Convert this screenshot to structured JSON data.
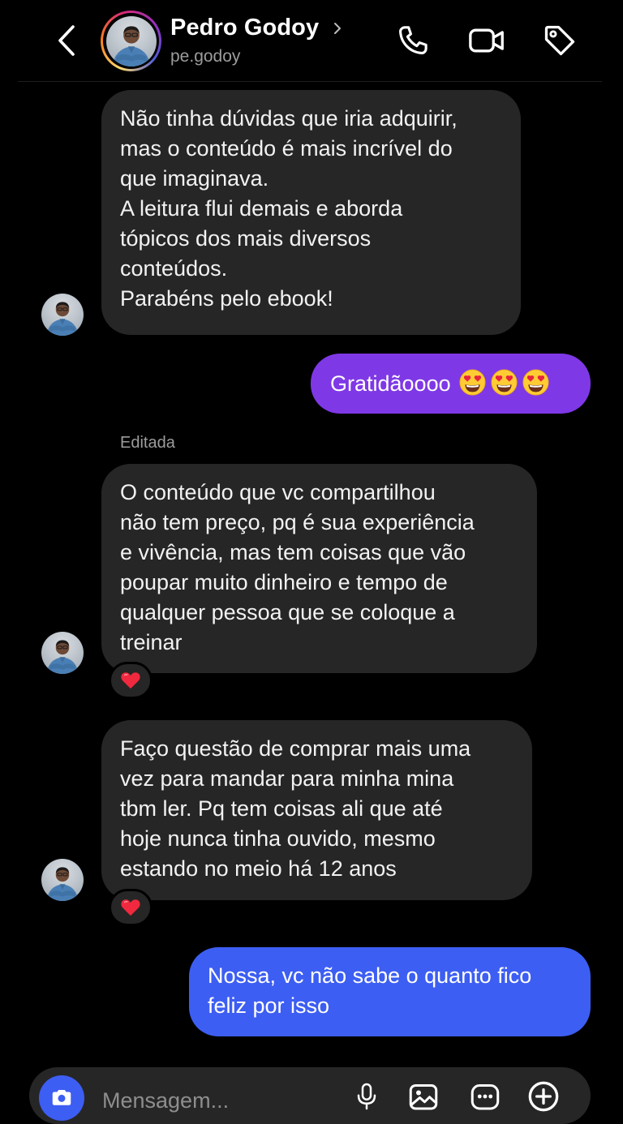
{
  "header": {
    "contact_name": "Pedro Godoy",
    "contact_handle": "pe.godoy",
    "icons": [
      "back-chevron-icon",
      "phone-icon",
      "video-camera-icon",
      "tag-icon"
    ]
  },
  "messages": [
    {
      "direction": "received",
      "lines": [
        "Não tinha dúvidas que iria adquirir,",
        "mas o conteúdo é mais incrível do",
        "que imaginava.",
        "A leitura flui demais e aborda",
        "tópicos dos mais diversos",
        "conteúdos.",
        "Parabéns pelo ebook!"
      ]
    },
    {
      "direction": "sent",
      "text": "Gratidãoooo",
      "emojis": [
        "heart-eyes-emoji",
        "heart-eyes-emoji",
        "heart-eyes-emoji"
      ]
    },
    {
      "direction": "received",
      "edited_label": "Editada",
      "lines": [
        "O conteúdo que vc compartilhou",
        "não tem preço, pq é sua experiência",
        "e vivência, mas tem coisas que vão",
        "poupar muito dinheiro e tempo de",
        "qualquer pessoa que se coloque a",
        "treinar"
      ],
      "reaction": "heart-emoji"
    },
    {
      "direction": "received",
      "lines": [
        "Faço questão de comprar mais uma",
        "vez para mandar para minha mina",
        "tbm ler. Pq tem coisas ali que até",
        "hoje nunca tinha ouvido, mesmo",
        "estando no meio há 12 anos"
      ],
      "reaction": "heart-emoji"
    },
    {
      "direction": "sent",
      "lines": [
        "Nossa, vc não sabe o quanto fico",
        "feliz por isso"
      ]
    }
  ],
  "composer": {
    "placeholder": "Mensagem...",
    "icons": [
      "camera-icon",
      "microphone-icon",
      "gallery-icon",
      "sticker-icon",
      "plus-icon"
    ]
  },
  "colors": {
    "background": "#000000",
    "received_bubble": "#262626",
    "sent_purple_bubble": "#7f38e6",
    "sent_blue_bubble": "#3d5ef2",
    "secondary_text": "#9c9c9c"
  }
}
